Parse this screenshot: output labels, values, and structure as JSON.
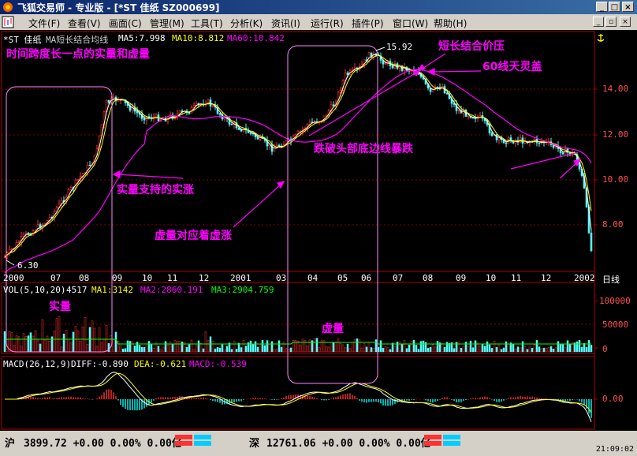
{
  "window": {
    "title": "飞狐交易师 - 专业版 - [*ST 佳纸 SZ000699]",
    "buttons": {
      "minimize": "_",
      "maximize": "□",
      "close": "×"
    }
  },
  "menu": {
    "items": [
      "文件(F)",
      "查看(V)",
      "画面(C)",
      "管理(M)",
      "工具(T)",
      "分析(K)",
      "资讯(I)",
      "运行(R)",
      "插件(P)",
      "窗口(W)",
      "帮助(H)"
    ],
    "mdi_buttons": {
      "minimize": "_",
      "restore": "▫",
      "close": "×"
    }
  },
  "price_panel": {
    "legend_stock": "*ST 佳纸",
    "legend_ma_name": "MA短长结合均线",
    "legend_ma5": "MA5:7.998",
    "legend_ma10": "MA10:8.812",
    "legend_ma60": "MA60:10.842",
    "y_ticks": [
      "14.00",
      "12.00",
      "10.00",
      "8.00"
    ],
    "high_label": "15.92",
    "low_label": "6.30",
    "x_ticks": [
      "2000",
      "07",
      "08",
      "09",
      "10",
      "11",
      "12",
      "2001",
      "03",
      "04",
      "05",
      "06",
      "07",
      "08",
      "09",
      "10",
      "11",
      "12",
      "2002"
    ],
    "period": "日线"
  },
  "annotations": {
    "top_left": "时间跨度长一点的实量和虚量",
    "short_long": "短长结合价压",
    "ma60": "60线天灵盖",
    "break": "跌破头部底边线暴跌",
    "real_support": "实量支持的实涨",
    "virtual": "虚量对应着虚涨",
    "real_vol": "实量",
    "virtual_vol": "虚量"
  },
  "vol_panel": {
    "legend_name": "VOL(5,10,20)",
    "legend_vol": "4517",
    "legend_ma1": "MA1:3142",
    "legend_ma2": "MA2:2860.191",
    "legend_ma3": "MA3:2904.759",
    "y_ticks": [
      "100000",
      "50000",
      "0"
    ]
  },
  "macd_panel": {
    "legend_name": "MACD(26,12,9)",
    "legend_diff": "DIFF:-0.890",
    "legend_dea": "DEA:-0.621",
    "legend_macd": "MACD:-0.539",
    "y_ticks": [
      "0.00"
    ]
  },
  "status": {
    "sh_label": "沪",
    "sh_index": "3899.72 +0.00 0.00% 0.00亿",
    "sz_label": "深",
    "sz_index": "12761.06 +0.00 0.00% 0.00亿",
    "time": "21:09:02"
  },
  "colors": {
    "candle_up": "#ff3232",
    "candle_down": "#54fcfc",
    "ma5": "#ffffff",
    "ma10": "#ffff00",
    "ma60": "#ff00ff",
    "annotation": "#ff00ff",
    "macd_up": "#ff3232",
    "macd_down": "#00ffff"
  }
}
